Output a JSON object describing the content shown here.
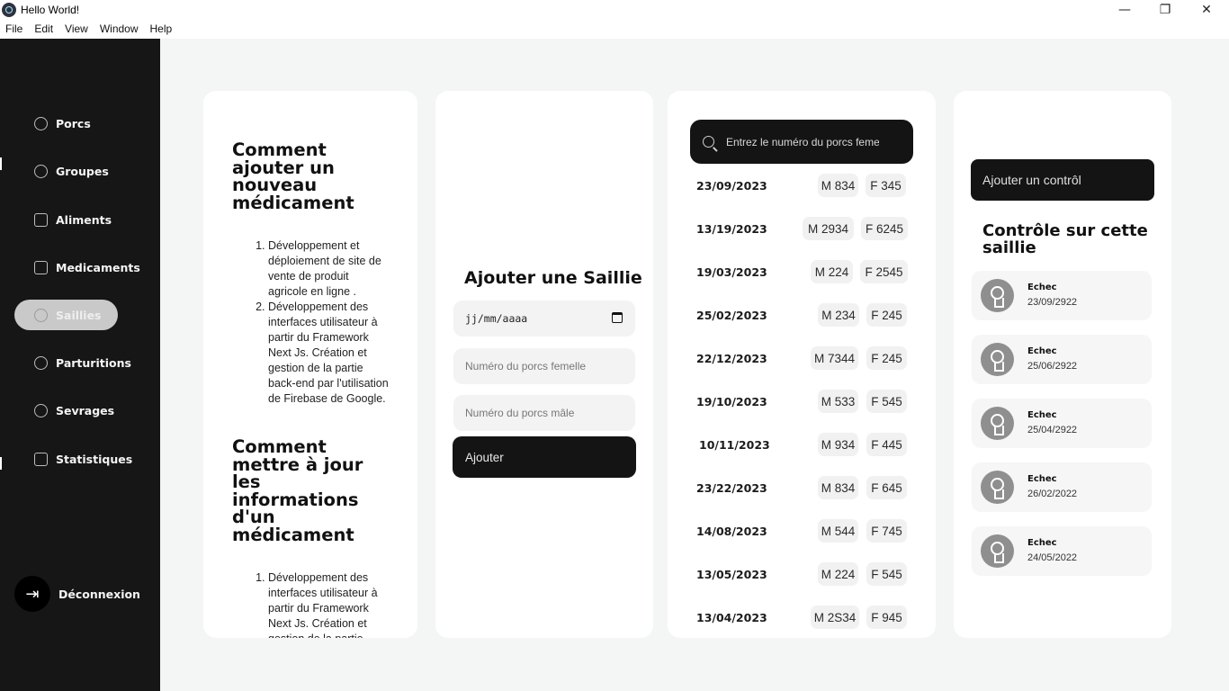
{
  "window": {
    "title": "Hello World!",
    "minimize": "—",
    "restore": "❐",
    "close": "✕"
  },
  "menu": [
    "File",
    "Edit",
    "View",
    "Window",
    "Help"
  ],
  "sidebar": {
    "items": [
      {
        "label": "Porcs",
        "icon": "gauge-icon"
      },
      {
        "label": "Groupes",
        "icon": "alarm-clock-icon"
      },
      {
        "label": "Aliments",
        "icon": "document-icon"
      },
      {
        "label": "Medicaments",
        "icon": "receipt-icon"
      },
      {
        "label": "Saillies",
        "icon": "gauge-icon",
        "active": true
      },
      {
        "label": "Parturitions",
        "icon": "alarm-clock-icon"
      },
      {
        "label": "Sevrages",
        "icon": "gauge-icon"
      },
      {
        "label": "Statistiques",
        "icon": "receipt-icon"
      }
    ],
    "logout": {
      "label": "Déconnexion",
      "icon": "logout-icon"
    }
  },
  "docs": {
    "section1": {
      "heading": "Comment ajouter un nouveau médicament",
      "items": [
        "Développement et déploiement de site de vente de produit agricole en ligne .",
        "Développement des interfaces utilisateur à partir du Framework Next Js. Création et gestion de la partie back-end par l'utilisation de Firebase de Google."
      ]
    },
    "section2": {
      "heading": "Comment mettre à jour les informations d'un médicament",
      "items": [
        "Développement des interfaces utilisateur à partir du Framework Next Js. Création et gestion de la partie"
      ]
    }
  },
  "form": {
    "title": "Ajouter une Saillie",
    "date_placeholder": "jj/mm/aaaa",
    "female_placeholder": "Numéro du porcs femelle",
    "male_placeholder": "Numéro du porcs mâle",
    "submit_label": "Ajouter"
  },
  "list": {
    "search_placeholder": "Entrez le numéro du porcs femelle",
    "rows": [
      {
        "date": "23/09/2023",
        "male": "M 834",
        "female": "F 345"
      },
      {
        "date": "13/19/2023",
        "male": "M 2934",
        "female": "F 6245"
      },
      {
        "date": "19/03/2023",
        "male": "M 224",
        "female": "F 2545"
      },
      {
        "date": "25/02/2023",
        "male": "M 234",
        "female": "F 245"
      },
      {
        "date": "22/12/2023",
        "male": "M 7344",
        "female": "F 245"
      },
      {
        "date": "19/10/2023",
        "male": "M 533",
        "female": "F 545"
      },
      {
        "date": "10/11/2023",
        "male": "M 934",
        "female": "F 445"
      },
      {
        "date": "23/22/2023",
        "male": "M 834",
        "female": "F 645"
      },
      {
        "date": "14/08/2023",
        "male": "M 544",
        "female": "F 745"
      },
      {
        "date": "13/05/2023",
        "male": "M 224",
        "female": "F 545"
      },
      {
        "date": "13/04/2023",
        "male": "M 2S34",
        "female": "F 945"
      }
    ]
  },
  "controls": {
    "add_label": "Ajouter un contrôl",
    "title": "Contrôle sur cette saillie",
    "items": [
      {
        "status": "Echec",
        "date": "23/09/2922"
      },
      {
        "status": "Echec",
        "date": "25/06/2922"
      },
      {
        "status": "Echec",
        "date": "25/04/2922"
      },
      {
        "status": "Echec",
        "date": "26/02/2022"
      },
      {
        "status": "Echec",
        "date": "24/05/2022"
      }
    ]
  },
  "colors": {
    "sidebar": "#161616",
    "background": "#f3f6f5",
    "active_nav": "#c9c9c9",
    "button": "#141414"
  }
}
